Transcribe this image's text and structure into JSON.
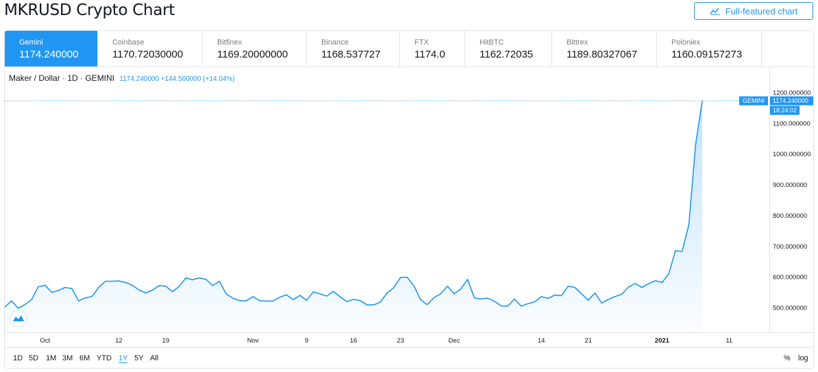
{
  "page": {
    "title": "MKRUSD Crypto Chart",
    "full_chart_label": "Full-featured chart"
  },
  "exchanges": [
    {
      "name": "Gemini",
      "price": "1174.240000",
      "active": true
    },
    {
      "name": "Coinbase",
      "price": "1170.72030000"
    },
    {
      "name": "Bitfinex",
      "price": "1169.20000000"
    },
    {
      "name": "Binance",
      "price": "1168.537727"
    },
    {
      "name": "FTX",
      "price": "1174.0"
    },
    {
      "name": "HitBTC",
      "price": "1162.72035"
    },
    {
      "name": "Bittrex",
      "price": "1189.80327067"
    },
    {
      "name": "Poloniex",
      "price": "1160.09157273"
    }
  ],
  "legend": {
    "symbol": "Maker / Dollar · 1D · GEMINI",
    "values": "1174.240000 +144.560000 (+14.04%)"
  },
  "price_tag": {
    "exchange": "GEMINI",
    "price": "1174.240000",
    "time": "18:24:02"
  },
  "ranges": [
    "1D",
    "5D",
    "1M",
    "3M",
    "6M",
    "YTD",
    "1Y",
    "5Y",
    "All"
  ],
  "active_range": "1Y",
  "scale_options": {
    "percent": "%",
    "log": "log"
  },
  "colors": {
    "accent": "#2196f3",
    "line": "#2196f3",
    "text": "#131722",
    "muted": "#787b86",
    "border": "#e0e3eb"
  },
  "chart_data": {
    "type": "area",
    "title": "",
    "xlabel": "",
    "ylabel": "",
    "ylim": [
      420,
      1200
    ],
    "yticks": [
      "1200.000000",
      "1100.000000",
      "1000.000000",
      "900.000000",
      "800.000000",
      "700.000000",
      "600.000000",
      "500.000000"
    ],
    "ytick_values": [
      1200,
      1100,
      1000,
      900,
      800,
      700,
      600,
      500
    ],
    "xticks": [
      {
        "label": "Oct",
        "date": "2020-10-01"
      },
      {
        "label": "12",
        "date": "2020-10-12"
      },
      {
        "label": "19",
        "date": "2020-10-19"
      },
      {
        "label": "Nov",
        "date": "2020-11-01"
      },
      {
        "label": "9",
        "date": "2020-11-09"
      },
      {
        "label": "16",
        "date": "2020-11-16"
      },
      {
        "label": "23",
        "date": "2020-11-23"
      },
      {
        "label": "Dec",
        "date": "2020-12-01"
      },
      {
        "label": "14",
        "date": "2020-12-14"
      },
      {
        "label": "21",
        "date": "2020-12-21"
      },
      {
        "label": "2021",
        "date": "2021-01-01"
      },
      {
        "label": "11",
        "date": "2021-01-11"
      }
    ],
    "x_domain": [
      "2020-09-25",
      "2021-01-17"
    ],
    "series": [
      {
        "x": [
          "2020-09-25",
          "2020-09-26",
          "2020-09-27",
          "2020-09-28",
          "2020-09-29",
          "2020-09-30",
          "2020-10-01",
          "2020-10-02",
          "2020-10-03",
          "2020-10-04",
          "2020-10-05",
          "2020-10-06",
          "2020-10-07",
          "2020-10-08",
          "2020-10-09",
          "2020-10-10",
          "2020-10-11",
          "2020-10-12",
          "2020-10-13",
          "2020-10-14",
          "2020-10-15",
          "2020-10-16",
          "2020-10-17",
          "2020-10-18",
          "2020-10-19",
          "2020-10-20",
          "2020-10-21",
          "2020-10-22",
          "2020-10-23",
          "2020-10-24",
          "2020-10-25",
          "2020-10-26",
          "2020-10-27",
          "2020-10-28",
          "2020-10-29",
          "2020-10-30",
          "2020-10-31",
          "2020-11-01",
          "2020-11-02",
          "2020-11-03",
          "2020-11-04",
          "2020-11-05",
          "2020-11-06",
          "2020-11-07",
          "2020-11-08",
          "2020-11-09",
          "2020-11-10",
          "2020-11-11",
          "2020-11-12",
          "2020-11-13",
          "2020-11-14",
          "2020-11-15",
          "2020-11-16",
          "2020-11-17",
          "2020-11-18",
          "2020-11-19",
          "2020-11-20",
          "2020-11-21",
          "2020-11-22",
          "2020-11-23",
          "2020-11-24",
          "2020-11-25",
          "2020-11-26",
          "2020-11-27",
          "2020-11-28",
          "2020-11-29",
          "2020-11-30",
          "2020-12-01",
          "2020-12-02",
          "2020-12-03",
          "2020-12-04",
          "2020-12-05",
          "2020-12-06",
          "2020-12-07",
          "2020-12-08",
          "2020-12-09",
          "2020-12-10",
          "2020-12-11",
          "2020-12-12",
          "2020-12-13",
          "2020-12-14",
          "2020-12-15",
          "2020-12-16",
          "2020-12-17",
          "2020-12-18",
          "2020-12-19",
          "2020-12-20",
          "2020-12-21",
          "2020-12-22",
          "2020-12-23",
          "2020-12-24",
          "2020-12-25",
          "2020-12-26",
          "2020-12-27",
          "2020-12-28",
          "2020-12-29",
          "2020-12-30",
          "2020-12-31",
          "2021-01-01",
          "2021-01-02",
          "2021-01-03",
          "2021-01-04",
          "2021-01-05",
          "2021-01-06",
          "2021-01-07"
        ],
        "values": [
          502,
          522,
          498,
          510,
          526,
          568,
          573,
          550,
          556,
          566,
          562,
          522,
          532,
          536,
          566,
          586,
          586,
          587,
          582,
          573,
          558,
          548,
          557,
          572,
          570,
          552,
          569,
          597,
          591,
          597,
          592,
          572,
          586,
          545,
          531,
          523,
          522,
          536,
          523,
          521,
          522,
          534,
          542,
          526,
          540,
          524,
          551,
          545,
          538,
          553,
          535,
          520,
          527,
          523,
          509,
          509,
          518,
          548,
          565,
          598,
          599,
          571,
          526,
          510,
          533,
          545,
          570,
          545,
          561,
          592,
          532,
          528,
          531,
          521,
          506,
          505,
          528,
          505,
          513,
          519,
          536,
          530,
          541,
          539,
          570,
          566,
          545,
          524,
          548,
          515,
          527,
          536,
          544,
          567,
          579,
          566,
          578,
          588,
          582,
          610,
          685,
          683,
          770,
          1030,
          1174
        ]
      }
    ]
  }
}
